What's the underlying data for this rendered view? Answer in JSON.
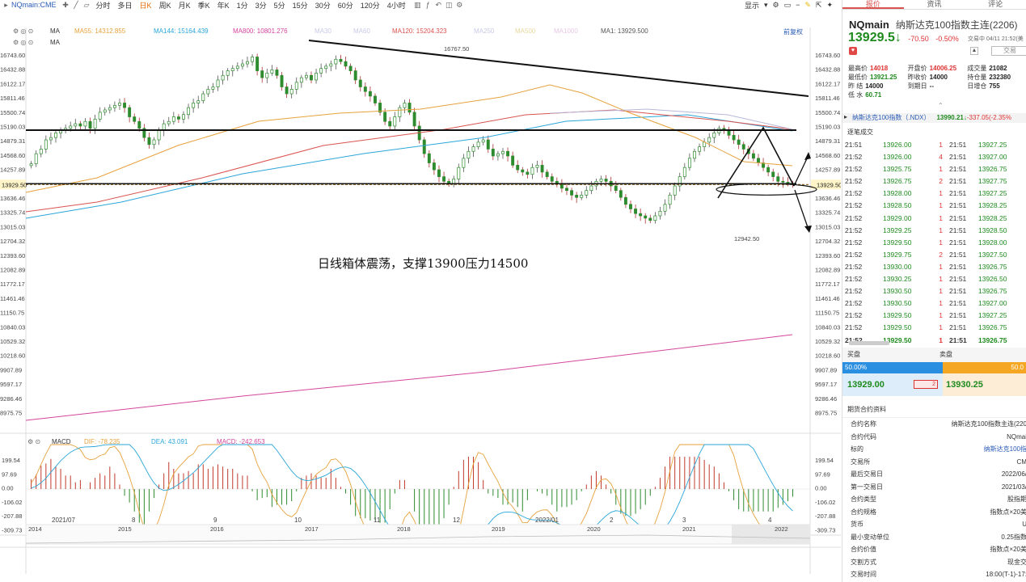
{
  "toolbar": {
    "symbol": "NQmain:CME",
    "periods": [
      "分时",
      "多日",
      "日K",
      "周K",
      "月K",
      "季K",
      "年K",
      "1分",
      "3分",
      "5分",
      "15分",
      "30分",
      "60分",
      "120分",
      "4小时"
    ],
    "active_period": "日K",
    "display_label": "显示"
  },
  "legend": {
    "row1_label": "MA",
    "row2_label": "MA",
    "ma55": "MA55: 14312.855",
    "ma144": "MA144: 15164.439",
    "ma800": "MA800: 10801.276",
    "ma30": "MA30",
    "ma60": "MA60",
    "ma120": "MA120: 15204.323",
    "ma250": "MA250",
    "ma500": "MA500",
    "ma1000": "MA1000",
    "ma1": "MA1: 13929.500",
    "adjust": "前复权",
    "colors": {
      "ma55": "#e6a23c",
      "ma144": "#2aa6d9",
      "ma800": "#d3459e",
      "ma120": "#d9534f",
      "ma1": "#555555",
      "faded": "#c9c9e8"
    }
  },
  "price_axis": [
    "16743.60",
    "16432.88",
    "16122.17",
    "15811.46",
    "15500.74",
    "15190.03",
    "14879.31",
    "14568.60",
    "14257.89",
    "13929.50",
    "13636.46",
    "13325.74",
    "13015.03",
    "12704.32",
    "12393.60",
    "12082.89",
    "11772.17",
    "11461.46",
    "11150.75",
    "10840.03",
    "10529.32",
    "10218.60",
    "9907.89",
    "9597.17",
    "9286.46",
    "8975.75"
  ],
  "price_axis_left": [
    "16743.60",
    "16432.88",
    "16122.17",
    "15811.46",
    "15500.74",
    "15190.03",
    "14879.31",
    "14568.60",
    "14257.89",
    "13929.50",
    "13636.46",
    "13325.74",
    "13015.03",
    "12704.32",
    "12393.60",
    "12082.89",
    "11772.17",
    "11461.46",
    "11150.75",
    "10840.03",
    "10529.32",
    "10218.60",
    "9907.89",
    "9597.17",
    "9286.46",
    "8975.75"
  ],
  "current_price_tag": "13929.50",
  "high_label": "16767.50",
  "low_label": "12942.50",
  "annotation": "日线箱体震荡，支撑13900压力14500",
  "macd": {
    "label": "MACD",
    "dif": "DIF: -78.235",
    "dea": "DEA: 43.091",
    "macd": "MACD: -242.653",
    "axis": [
      "199.54",
      "97.69",
      "0.00",
      "-106.02",
      "-207.88",
      "-309.73"
    ],
    "colors": {
      "dif": "#e6a23c",
      "dea": "#2aa6d9",
      "macd": "#d3459e"
    }
  },
  "time_axis": [
    "2021/07",
    "8",
    "9",
    "10",
    "11",
    "12",
    "2022/01",
    "2",
    "3",
    "4"
  ],
  "overview_axis": [
    "2014",
    "2015",
    "2016",
    "2017",
    "2018",
    "2019",
    "2020",
    "2021",
    "2022"
  ],
  "panel": {
    "tabs": [
      "报价",
      "资讯",
      "评论"
    ],
    "active_tab": "报价",
    "code": "NQmain",
    "name": "纳斯达克100指数主连(2206)",
    "price": "13929.5",
    "arrow": "↓",
    "change": "-70.50",
    "pct": "-0.50%",
    "time": "交易中 04/11 21:52(美",
    "trade_btn": "交易",
    "stats": [
      [
        {
          "k": "最高价",
          "v": "14018",
          "c": "red"
        },
        {
          "k": "开盘价",
          "v": "14006.25",
          "c": "red"
        },
        {
          "k": "成交量",
          "v": "21082",
          "c": "black"
        }
      ],
      [
        {
          "k": "最低价",
          "v": "13921.25",
          "c": "green"
        },
        {
          "k": "昨收价",
          "v": "14000",
          "c": "black"
        },
        {
          "k": "持仓量",
          "v": "232380",
          "c": "black"
        }
      ],
      [
        {
          "k": "昨 结",
          "v": "14000",
          "c": "black"
        },
        {
          "k": "到期日",
          "v": "--",
          "c": "black"
        },
        {
          "k": "日增仓",
          "v": "755",
          "c": "black"
        }
      ],
      [
        {
          "k": "低 水",
          "v": "60.71",
          "c": "green"
        },
        {
          "k": "",
          "v": "",
          "c": "black"
        },
        {
          "k": "",
          "v": "",
          "c": "black"
        }
      ]
    ],
    "index_name": "纳斯达克100指数（.NDX）",
    "index_value": "13990.21↓",
    "index_change": "-337.05(-2.35%",
    "ticks_label": "逐笔成交",
    "ticks": [
      {
        "t1": "21:51",
        "p1": "13926.00",
        "q": "1",
        "t2": "21:51",
        "p2": "13927.25"
      },
      {
        "t1": "21:52",
        "p1": "13926.00",
        "q": "4",
        "t2": "21:51",
        "p2": "13927.00"
      },
      {
        "t1": "21:52",
        "p1": "13925.75",
        "q": "1",
        "t2": "21:51",
        "p2": "13926.75"
      },
      {
        "t1": "21:52",
        "p1": "13926.75",
        "q": "2",
        "t2": "21:51",
        "p2": "13927.75"
      },
      {
        "t1": "21:52",
        "p1": "13928.00",
        "q": "1",
        "t2": "21:51",
        "p2": "13927.25"
      },
      {
        "t1": "21:52",
        "p1": "13928.50",
        "q": "1",
        "t2": "21:51",
        "p2": "13928.25"
      },
      {
        "t1": "21:52",
        "p1": "13929.00",
        "q": "1",
        "t2": "21:51",
        "p2": "13928.25"
      },
      {
        "t1": "21:52",
        "p1": "13929.25",
        "q": "1",
        "t2": "21:51",
        "p2": "13928.50"
      },
      {
        "t1": "21:52",
        "p1": "13929.50",
        "q": "1",
        "t2": "21:51",
        "p2": "13928.00"
      },
      {
        "t1": "21:52",
        "p1": "13929.75",
        "q": "2",
        "t2": "21:51",
        "p2": "13927.50"
      },
      {
        "t1": "21:52",
        "p1": "13930.00",
        "q": "1",
        "t2": "21:51",
        "p2": "13926.75"
      },
      {
        "t1": "21:52",
        "p1": "13930.25",
        "q": "1",
        "t2": "21:51",
        "p2": "13926.50"
      },
      {
        "t1": "21:52",
        "p1": "13930.50",
        "q": "1",
        "t2": "21:51",
        "p2": "13926.75"
      },
      {
        "t1": "21:52",
        "p1": "13930.50",
        "q": "1",
        "t2": "21:51",
        "p2": "13927.00"
      },
      {
        "t1": "21:52",
        "p1": "13929.50",
        "q": "1",
        "t2": "21:51",
        "p2": "13927.25"
      },
      {
        "t1": "21:52",
        "p1": "13929.50",
        "q": "1",
        "t2": "21:51",
        "p2": "13926.75"
      },
      {
        "t1": "21:52",
        "p1": "13929.50",
        "q": "1",
        "t2": "21:51",
        "p2": "13926.75"
      }
    ],
    "bid_label": "买盘",
    "ask_label": "卖盘",
    "bid_pct": "50.00%",
    "ask_pct": "50.0",
    "bid_price": "13929.00",
    "bid_qty": "2",
    "ask_price": "13930.25",
    "info_title": "期货合约资料",
    "info": [
      {
        "k": "合约名称",
        "v": "纳斯达克100指数主连(220"
      },
      {
        "k": "合约代码",
        "v": "NQmai"
      },
      {
        "k": "标的",
        "v": "纳斯达克100指",
        "link": true
      },
      {
        "k": "交易所",
        "v": "CM"
      },
      {
        "k": "最后交易日",
        "v": "2022/06/"
      },
      {
        "k": "第一交易日",
        "v": "2021/03/"
      },
      {
        "k": "合约类型",
        "v": "股指期"
      },
      {
        "k": "合约规格",
        "v": "指数点×20美"
      },
      {
        "k": "货币",
        "v": "U"
      },
      {
        "k": "最小变动单位",
        "v": "0.25指数"
      },
      {
        "k": "合约价值",
        "v": "指数点×20美"
      },
      {
        "k": "交割方式",
        "v": "现金交"
      },
      {
        "k": "交易时间",
        "v": "18:00(T-1)-17:"
      }
    ]
  }
}
